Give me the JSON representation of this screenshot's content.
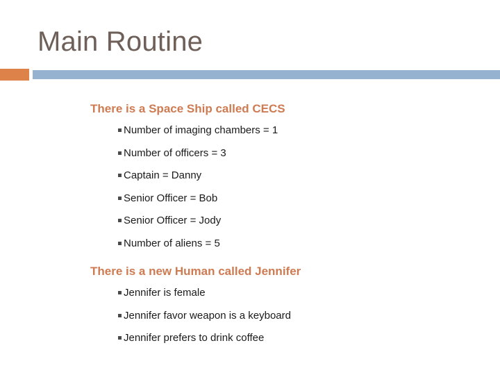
{
  "slide": {
    "title": "Main Routine",
    "colors": {
      "title_text": "#6E6058",
      "accent_bar": "#DD8248",
      "main_bar": "#95B3D0",
      "heading_text": "#CE7B52",
      "body_text": "#1a1a1a"
    },
    "groups": [
      {
        "heading": "There is a Space Ship called CECS",
        "bullets": [
          "Number of imaging chambers = 1",
          "Number of officers = 3",
          "Captain = Danny",
          "Senior Officer = Bob",
          "Senior Officer = Jody",
          "Number of aliens = 5"
        ]
      },
      {
        "heading": "There is a new Human called Jennifer",
        "bullets": [
          "Jennifer is female",
          "Jennifer favor weapon is a keyboard",
          "Jennifer prefers to drink coffee"
        ]
      }
    ]
  }
}
